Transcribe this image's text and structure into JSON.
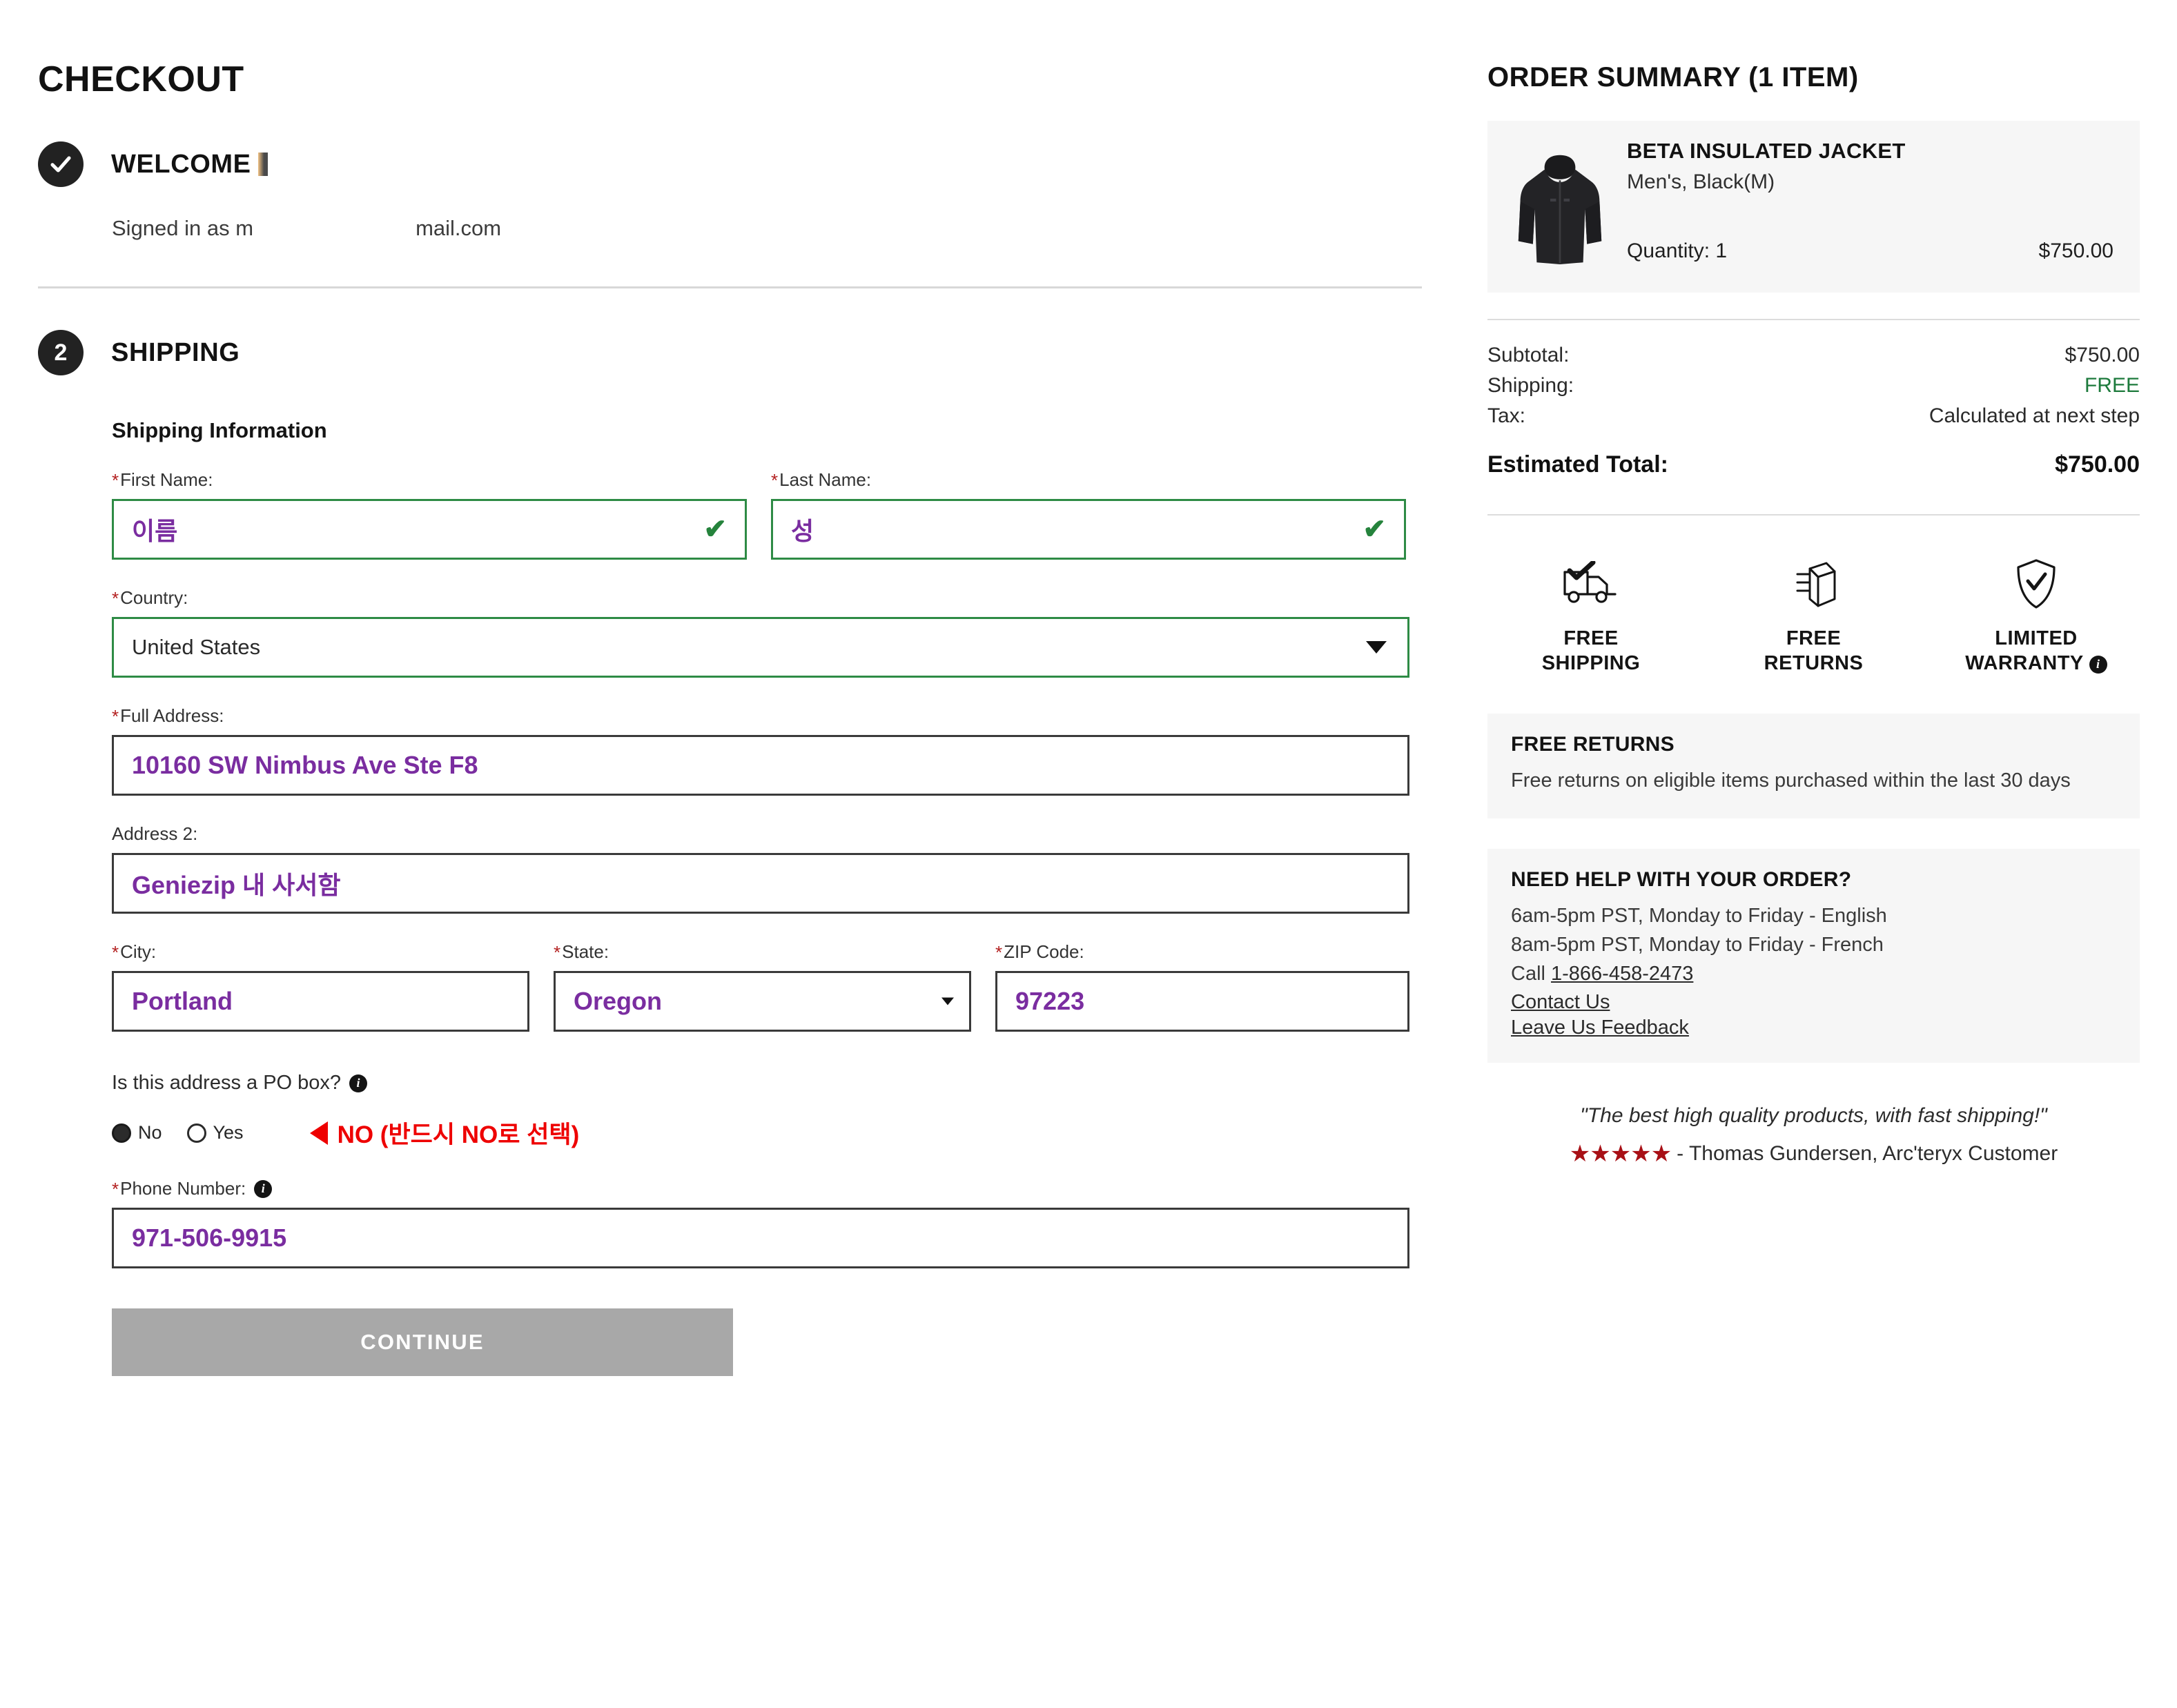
{
  "page": {
    "title": "CHECKOUT"
  },
  "steps": {
    "welcome": {
      "badge_icon": "check-icon",
      "title": "WELCOME",
      "signed_in_prefix": "Signed in as m",
      "signed_in_suffix": "mail.com"
    },
    "shipping": {
      "badge_number": "2",
      "title": "SHIPPING",
      "sub_heading": "Shipping Information"
    }
  },
  "form": {
    "first_name": {
      "label": "First Name:",
      "required": true,
      "value": "이름",
      "valid": true
    },
    "last_name": {
      "label": "Last Name:",
      "required": true,
      "value": "성",
      "valid": true
    },
    "country": {
      "label": "Country:",
      "required": true,
      "value": "United States",
      "valid": true
    },
    "full_address": {
      "label": "Full Address:",
      "required": true,
      "value": "10160 SW Nimbus Ave Ste F8"
    },
    "address2": {
      "label": "Address 2:",
      "required": false,
      "value": "Geniezip 내 사서함"
    },
    "city": {
      "label": "City:",
      "required": true,
      "value": "Portland"
    },
    "state": {
      "label": "State:",
      "required": true,
      "value": "Oregon"
    },
    "zip": {
      "label": "ZIP Code:",
      "required": true,
      "value": "97223"
    },
    "po_box": {
      "question": "Is this address a PO box?",
      "info_icon": "info-icon",
      "option_no": "No",
      "option_yes": "Yes",
      "selected": "No",
      "annotation": "NO (반드시 NO로 선택)"
    },
    "phone": {
      "label": "Phone Number:",
      "required": true,
      "value": "971-506-9915",
      "info_icon": "info-icon"
    },
    "continue_button": "CONTINUE"
  },
  "order_summary": {
    "title": "ORDER SUMMARY (1 ITEM)",
    "item": {
      "name": "BETA INSULATED JACKET",
      "variant": "Men's, Black(M)",
      "quantity_label": "Quantity: 1",
      "price": "$750.00",
      "thumb_icon": "jacket-icon"
    },
    "totals": [
      {
        "label": "Subtotal:",
        "value": "$750.00",
        "style": "normal"
      },
      {
        "label": "Shipping:",
        "value": "FREE",
        "style": "free"
      },
      {
        "label": "Tax:",
        "value": "Calculated at next step",
        "style": "normal"
      }
    ],
    "estimated_total": {
      "label": "Estimated Total:",
      "value": "$750.00"
    }
  },
  "badges": [
    {
      "icon": "delivery-truck-icon",
      "line1": "FREE",
      "line2": "SHIPPING",
      "has_info": false
    },
    {
      "icon": "package-box-icon",
      "line1": "FREE",
      "line2": "RETURNS",
      "has_info": false
    },
    {
      "icon": "shield-check-icon",
      "line1": "LIMITED",
      "line2": "WARRANTY",
      "has_info": true
    }
  ],
  "free_returns_box": {
    "title": "FREE RETURNS",
    "text": "Free returns on eligible items purchased within the last 30 days"
  },
  "help_box": {
    "title": "NEED HELP WITH YOUR ORDER?",
    "hours_english": "6am-5pm PST, Monday to Friday - English",
    "hours_french": "8am-5pm PST, Monday to Friday - French",
    "call_prefix": "Call ",
    "phone": "1-866-458-2473",
    "contact_link": "Contact Us",
    "feedback_link": "Leave Us Feedback"
  },
  "testimonial": {
    "quote": "\"The best high quality products, with fast shipping!\"",
    "stars": "★★★★★",
    "attribution": "- Thomas Gundersen, Arc'teryx Customer"
  },
  "colors": {
    "accent_purple": "#7a2da0",
    "valid_green": "#2e8b45",
    "free_green": "#1d7a3c",
    "annotation_red": "#ee0000",
    "star_red": "#a81016",
    "button_disabled": "#a8a8a8"
  }
}
